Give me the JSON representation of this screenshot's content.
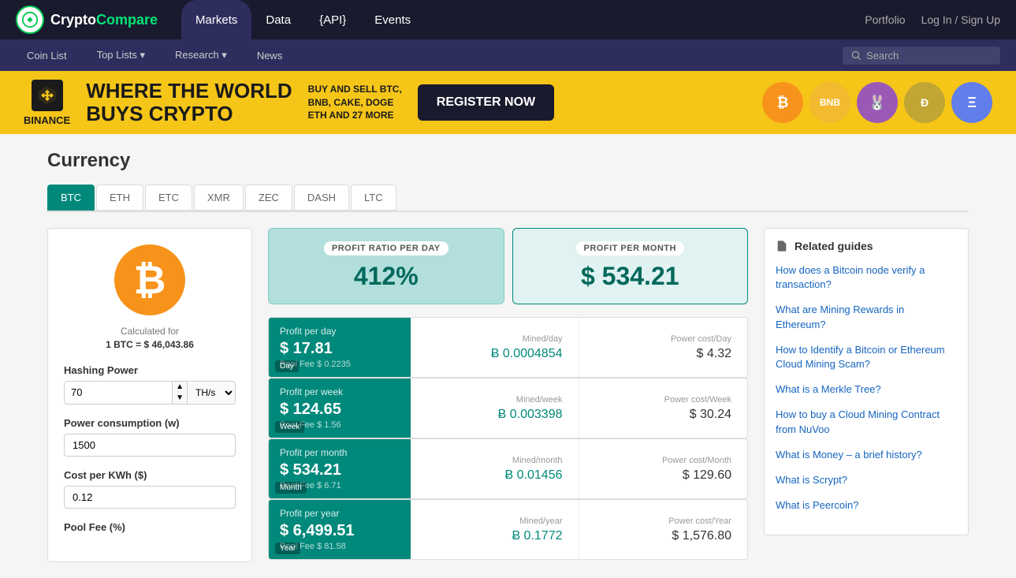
{
  "logo": {
    "text_dark": "Crypto",
    "text_green": "Compare"
  },
  "top_nav": {
    "items": [
      {
        "label": "Markets",
        "active": true
      },
      {
        "label": "Data",
        "active": false
      },
      {
        "label": "{API}",
        "active": false
      },
      {
        "label": "Events",
        "active": false
      }
    ],
    "portfolio": "Portfolio",
    "login": "Log In / Sign Up"
  },
  "secondary_nav": {
    "items": [
      {
        "label": "Coin List"
      },
      {
        "label": "Top Lists ▾"
      },
      {
        "label": "Research ▾"
      },
      {
        "label": "News"
      }
    ],
    "search_placeholder": "Search"
  },
  "banner": {
    "brand": "BINANCE",
    "headline_line1": "WHERE THE WORLD",
    "headline_line2": "BUYS CRYPTO",
    "sub": "BUY AND SELL BTC, BNB, CAKE, DOGE\nETH AND 27 MORE",
    "cta": "REGISTER NOW"
  },
  "page": {
    "title": "Currency",
    "tabs": [
      "BTC",
      "ETH",
      "ETC",
      "XMR",
      "ZEC",
      "DASH",
      "LTC"
    ],
    "active_tab": "BTC"
  },
  "calculator": {
    "calculated_for_label": "Calculated for",
    "btc_rate": "1 BTC = $ 46,043.86",
    "hashing_power_label": "Hashing Power",
    "hashing_power_value": "70",
    "hashing_unit": "TH/s",
    "power_consumption_label": "Power consumption (w)",
    "power_consumption_value": "1500",
    "cost_per_kwh_label": "Cost per KWh ($)",
    "cost_per_kwh_value": "0.12",
    "pool_fee_label": "Pool Fee (%)"
  },
  "profit_summary": {
    "day_label": "PROFIT RATIO PER DAY",
    "day_value": "412%",
    "month_label": "PROFIT PER MONTH",
    "month_value": "$ 534.21"
  },
  "profit_rows": [
    {
      "period": "Day",
      "profit_label": "Profit per day",
      "profit_value": "$ 17.81",
      "pool_fee": "Pool Fee $ 0.2235",
      "mined_label": "Mined/day",
      "mined_value": "Ƀ 0.0004854",
      "power_label": "Power cost/Day",
      "power_value": "$ 4.32"
    },
    {
      "period": "Week",
      "profit_label": "Profit per week",
      "profit_value": "$ 124.65",
      "pool_fee": "Pool Fee $ 1.56",
      "mined_label": "Mined/week",
      "mined_value": "Ƀ 0.003398",
      "power_label": "Power cost/Week",
      "power_value": "$ 30.24"
    },
    {
      "period": "Month",
      "profit_label": "Profit per month",
      "profit_value": "$ 534.21",
      "pool_fee": "Pool Fee $ 6.71",
      "mined_label": "Mined/month",
      "mined_value": "Ƀ 0.01456",
      "power_label": "Power cost/Month",
      "power_value": "$ 129.60"
    },
    {
      "period": "Year",
      "profit_label": "Profit per year",
      "profit_value": "$ 6,499.51",
      "pool_fee": "Pool Fee $ 81.58",
      "mined_label": "Mined/year",
      "mined_value": "Ƀ 0.1772",
      "power_label": "Power cost/Year",
      "power_value": "$ 1,576.80"
    }
  ],
  "related_guides": {
    "title": "Related guides",
    "guides": [
      {
        "text": "How does a Bitcoin node verify a transaction?"
      },
      {
        "text": "What are Mining Rewards in Ethereum?"
      },
      {
        "text": "How to Identify a Bitcoin or Ethereum Cloud Mining Scam?"
      },
      {
        "text": "What is a Merkle Tree?"
      },
      {
        "text": "How to buy a Cloud Mining Contract from NuVoo"
      },
      {
        "text": "What is Money – a brief history?"
      },
      {
        "text": "What is Scrypt?"
      },
      {
        "text": "What is Peercoin?"
      }
    ]
  }
}
